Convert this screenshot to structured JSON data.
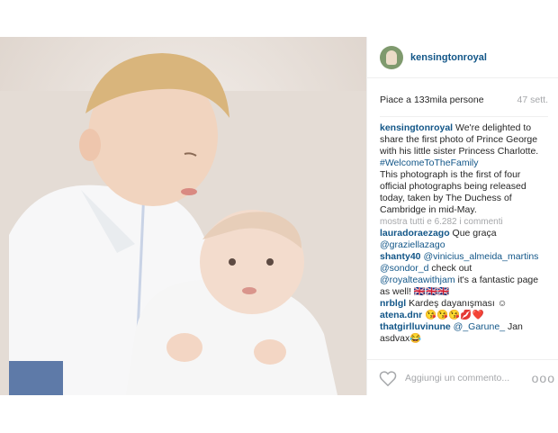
{
  "header": {
    "username": "kensingtonroyal",
    "avatar_icon": "avatar-photo"
  },
  "post": {
    "likes_text": "Piace a 133mila persone",
    "time_text": "47 sett.",
    "caption_user": "kensingtonroyal",
    "caption_text": " We're delighted to share the first photo of Prince George with his little sister Princess Charlotte. ",
    "caption_hashtag": "#WelcomeToTheFamily",
    "caption_text2": "This photograph is the first of four official photographs being released today, taken by The Duchess of Cambridge in mid-May.",
    "show_all_comments": "mostra tutti e 6.282 i commenti"
  },
  "comments": [
    {
      "user": "lauradoraezago",
      "text": " Que graça ",
      "mention": "@graziellazago",
      "text_after": ""
    },
    {
      "user": "shanty40",
      "text": " ",
      "mention": "@vinicius_almeida_martins",
      "text_after": ""
    },
    {
      "user": "nrblgl",
      "text": " Kardeş dayanışması ☺",
      "mention": "",
      "text_after": ""
    },
    {
      "user": "atena.dnr",
      "text": " 😘😘😘💋❤️",
      "mention": "",
      "text_after": ""
    },
    {
      "user": "thatgirlluvinune",
      "text": " ",
      "mention": "@_Garune_",
      "text_after": " Jan asdvax😂"
    }
  ],
  "comment2_extra": {
    "mention": "@sondor_d",
    "text": " check out ",
    "mention2": "@royalteawithjam",
    "text2": " it's a fantastic page as well! 🇬🇧🇬🇧🇬🇧"
  },
  "footer": {
    "placeholder": "Aggiungi un commento...",
    "more_label": "ooo",
    "heart_icon": "heart-icon"
  },
  "colors": {
    "link": "#125688",
    "muted": "#a5a7aa",
    "text": "#262626"
  }
}
